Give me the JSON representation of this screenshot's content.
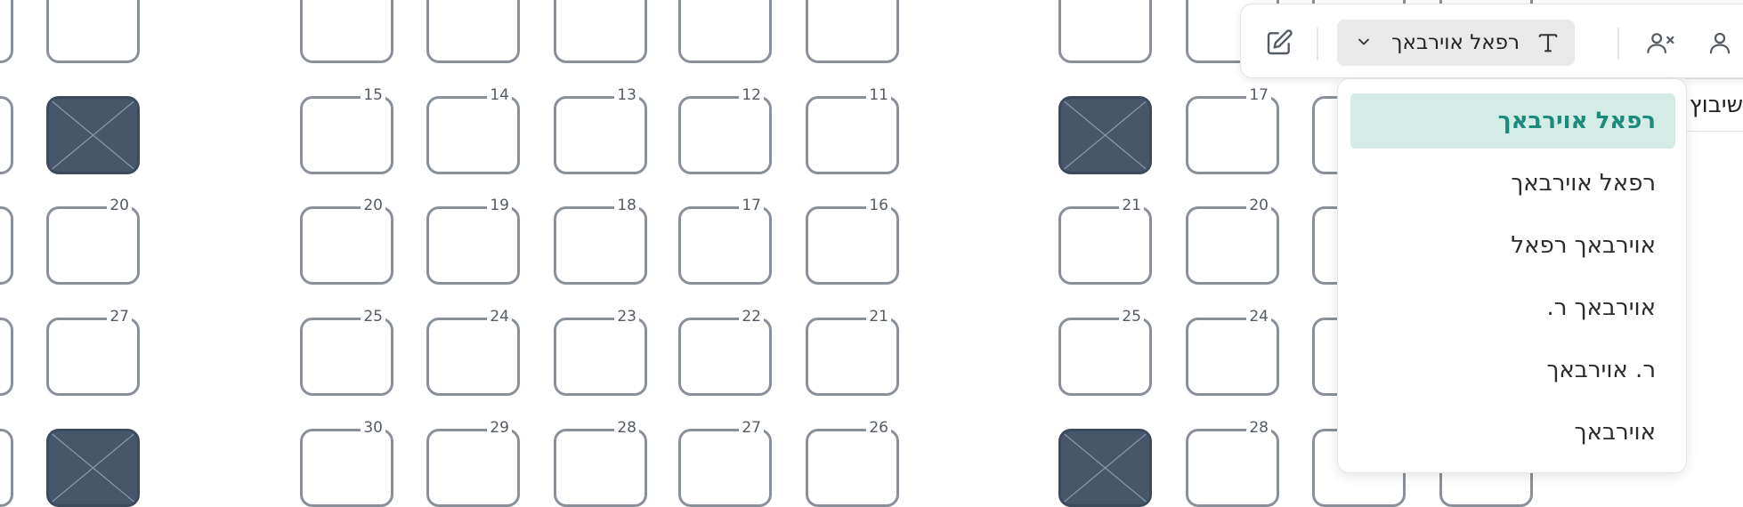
{
  "grid": {
    "rows": [
      {
        "cells": [
          {
            "col": "a",
            "label": "",
            "blocked": false
          },
          {
            "col": "b",
            "label": "",
            "blocked": false
          },
          {
            "col": "c",
            "label": "",
            "blocked": false
          },
          {
            "col": "d",
            "label": "",
            "blocked": false
          },
          {
            "col": "e",
            "label": "",
            "blocked": false
          },
          {
            "col": "f",
            "label": "",
            "blocked": false
          },
          {
            "col": "g",
            "label": "",
            "blocked": false
          },
          {
            "col": "h",
            "label": "",
            "blocked": false
          },
          {
            "col": "j",
            "label": "",
            "blocked": false
          },
          {
            "col": "k",
            "label": "",
            "blocked": false
          }
        ]
      },
      {
        "cells": [
          {
            "col": "a",
            "label": "",
            "blocked": true
          },
          {
            "col": "b",
            "label": "15",
            "blocked": false
          },
          {
            "col": "c",
            "label": "14",
            "blocked": false
          },
          {
            "col": "d",
            "label": "13",
            "blocked": false
          },
          {
            "col": "e",
            "label": "12",
            "blocked": false
          },
          {
            "col": "f",
            "label": "11",
            "blocked": false
          },
          {
            "col": "g",
            "label": "",
            "blocked": true
          },
          {
            "col": "h",
            "label": "17",
            "blocked": false
          },
          {
            "col": "j",
            "label": "",
            "blocked": false
          }
        ]
      },
      {
        "cells": [
          {
            "col": "a",
            "label": "20",
            "blocked": false
          },
          {
            "col": "b",
            "label": "20",
            "blocked": false
          },
          {
            "col": "c",
            "label": "19",
            "blocked": false
          },
          {
            "col": "d",
            "label": "18",
            "blocked": false
          },
          {
            "col": "e",
            "label": "17",
            "blocked": false
          },
          {
            "col": "f",
            "label": "16",
            "blocked": false
          },
          {
            "col": "g",
            "label": "21",
            "blocked": false
          },
          {
            "col": "h",
            "label": "20",
            "blocked": false
          },
          {
            "col": "j",
            "label": "",
            "blocked": false
          }
        ]
      },
      {
        "cells": [
          {
            "col": "a",
            "label": "27",
            "blocked": false
          },
          {
            "col": "b",
            "label": "25",
            "blocked": false
          },
          {
            "col": "c",
            "label": "24",
            "blocked": false
          },
          {
            "col": "d",
            "label": "23",
            "blocked": false
          },
          {
            "col": "e",
            "label": "22",
            "blocked": false
          },
          {
            "col": "f",
            "label": "21",
            "blocked": false
          },
          {
            "col": "g",
            "label": "25",
            "blocked": false
          },
          {
            "col": "h",
            "label": "24",
            "blocked": false
          },
          {
            "col": "j",
            "label": "",
            "blocked": false
          }
        ]
      },
      {
        "cells": [
          {
            "col": "a",
            "label": "",
            "blocked": true
          },
          {
            "col": "b",
            "label": "30",
            "blocked": false
          },
          {
            "col": "c",
            "label": "29",
            "blocked": false
          },
          {
            "col": "d",
            "label": "28",
            "blocked": false
          },
          {
            "col": "e",
            "label": "27",
            "blocked": false
          },
          {
            "col": "f",
            "label": "26",
            "blocked": false
          },
          {
            "col": "g",
            "label": "",
            "blocked": true
          },
          {
            "col": "h",
            "label": "28",
            "blocked": false
          },
          {
            "col": "j",
            "label": "",
            "blocked": false
          },
          {
            "col": "k",
            "label": "",
            "blocked": false
          }
        ]
      }
    ]
  },
  "toolbar": {
    "selected_format": "רפאל אוירבאך",
    "icons": [
      "person-icon",
      "person-remove-icon",
      "text-type-icon",
      "chevron-down-icon",
      "edit-icon"
    ]
  },
  "format_menu": {
    "options": [
      {
        "label": "רפאל אוירבאך",
        "active": true
      },
      {
        "label": "רפאל אוירבאך",
        "active": false
      },
      {
        "label": "אוירבאך רפאל",
        "active": false
      },
      {
        "label": "אוירבאך ר.",
        "active": false
      },
      {
        "label": "ר. אוירבאך",
        "active": false
      },
      {
        "label": "אוירבאך",
        "active": false
      }
    ]
  },
  "background_panel": {
    "partial_text": "שיבוץ"
  },
  "colors": {
    "accent_bg": "#d3ece6",
    "accent_text": "#1e8a7c",
    "blocked_cell": "#47576b",
    "cell_border": "#8a9099"
  }
}
